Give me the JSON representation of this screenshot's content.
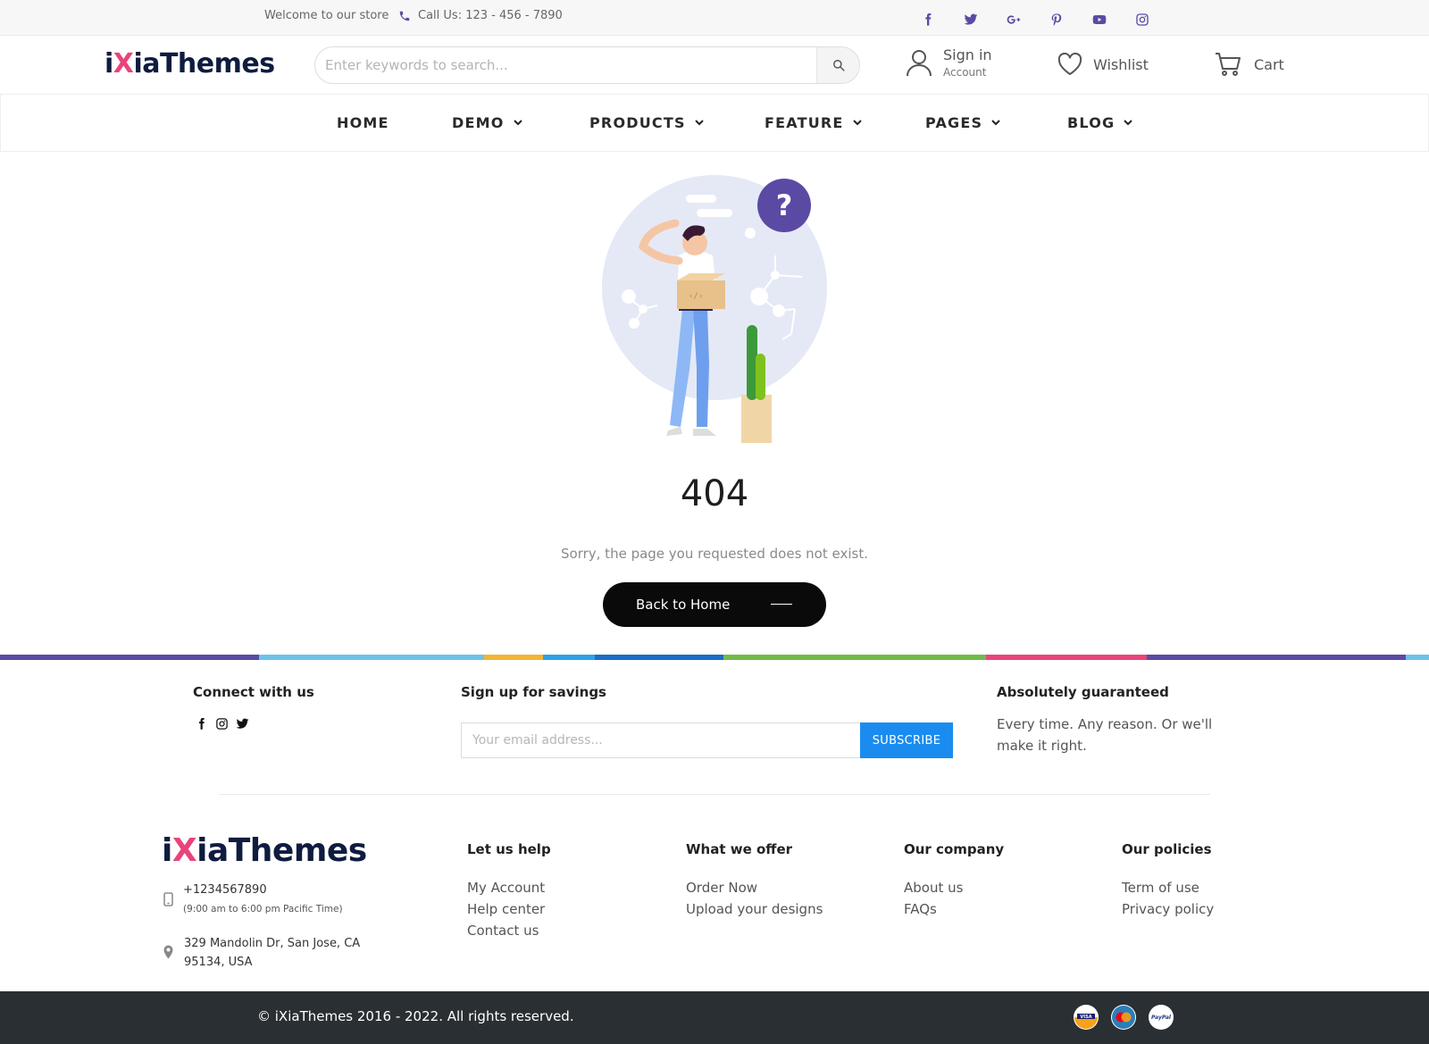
{
  "topbar": {
    "welcome": "Welcome to our store",
    "call": "Call Us: 123 - 456 - 7890",
    "socials": [
      "facebook-icon",
      "twitter-icon",
      "google-plus-icon",
      "pinterest-icon",
      "youtube-icon",
      "instagram-icon"
    ]
  },
  "header": {
    "logo_pre": "i",
    "logo_x": "X",
    "logo_post": "iaThemes",
    "search_placeholder": "Enter keywords to search...",
    "sign_in": "Sign in",
    "account": "Account",
    "wishlist": "Wishlist",
    "cart": "Cart"
  },
  "nav": [
    "HOME",
    "DEMO",
    "PRODUCTS",
    "FEATURE",
    "PAGES",
    "BLOG"
  ],
  "main": {
    "code": "404",
    "message": "Sorry, the page you requested does not exist.",
    "back_button": "Back to Home"
  },
  "footer": {
    "connect_title": "Connect with us",
    "signup_title": "Sign up for savings",
    "email_placeholder": "Your email address...",
    "subscribe": "SUBSCRIBE",
    "guarantee_title": "Absolutely guaranteed",
    "guarantee_text": "Every time. Any reason. Or we'll make it right.",
    "phone": "+1234567890",
    "hours": "(9:00 am to 6:00 pm Pacific Time)",
    "address_line1": "329 Mandolin Dr, San Jose, CA",
    "address_line2": "95134, USA",
    "columns": [
      {
        "title": "Let us help",
        "links": [
          "My Account",
          "Help center",
          "Contact us"
        ]
      },
      {
        "title": "What we offer",
        "links": [
          "Order Now",
          "Upload your designs"
        ]
      },
      {
        "title": "Our company",
        "links": [
          "About us",
          "FAQs"
        ]
      },
      {
        "title": "Our policies",
        "links": [
          "Term of use",
          "Privacy policy"
        ]
      }
    ],
    "copyright": "© iXiaThemes 2016 - 2022. All rights reserved.",
    "payments": [
      "visa-icon",
      "mastercard-icon",
      "paypal-icon"
    ]
  },
  "colors": {
    "accent": "#5b4aa4",
    "logo_x": "#e8447a",
    "subscribe": "#1a8cf0",
    "bottom_bar": "#2a2f33"
  }
}
